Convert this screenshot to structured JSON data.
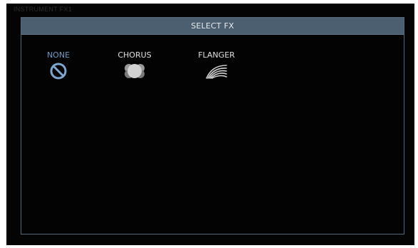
{
  "screen": {
    "breadcrumb": "INSTRUMENT FX1"
  },
  "dialog": {
    "title": "SELECT FX"
  },
  "fx_options": [
    {
      "label": "NONE",
      "icon": "none-icon",
      "selected": true,
      "color": "#6f9cc7"
    },
    {
      "label": "CHORUS",
      "icon": "chorus-icon",
      "selected": false,
      "color": "#d8d8d8"
    },
    {
      "label": "FLANGER",
      "icon": "flanger-icon",
      "selected": false,
      "color": "#d8d8d8"
    }
  ]
}
